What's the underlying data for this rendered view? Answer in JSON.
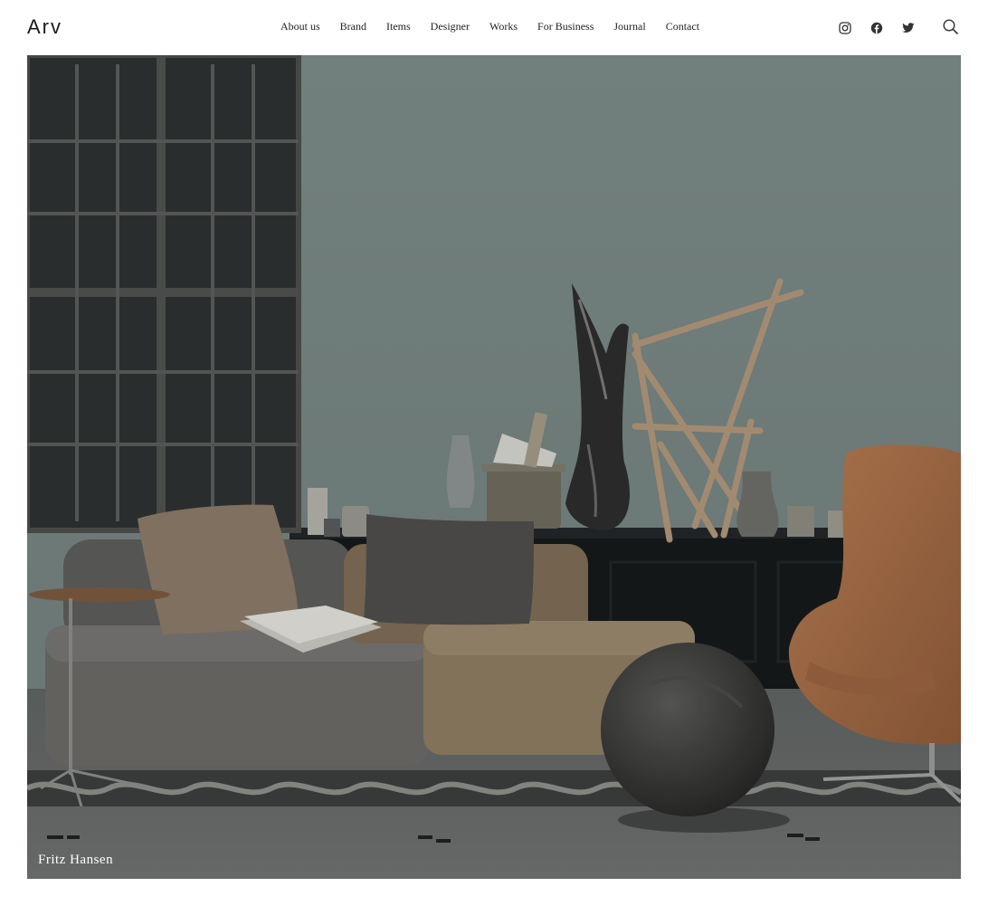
{
  "brand": {
    "logo": "Arv"
  },
  "nav": {
    "items": [
      {
        "label": "About us"
      },
      {
        "label": "Brand"
      },
      {
        "label": "Items"
      },
      {
        "label": "Designer"
      },
      {
        "label": "Works"
      },
      {
        "label": "For Business"
      },
      {
        "label": "Journal"
      },
      {
        "label": "Contact"
      }
    ]
  },
  "social": {
    "icons": [
      "instagram-icon",
      "facebook-icon",
      "twitter-icon"
    ]
  },
  "search": {
    "icon": "search-icon"
  },
  "hero": {
    "caption": "Fritz Hansen",
    "colors": {
      "wall": "#7d8b89",
      "sofa_grey": "#6b6a67",
      "sofa_tan": "#8e7c62",
      "chair": "#a5714d",
      "floor": "#5a5e5c"
    }
  }
}
